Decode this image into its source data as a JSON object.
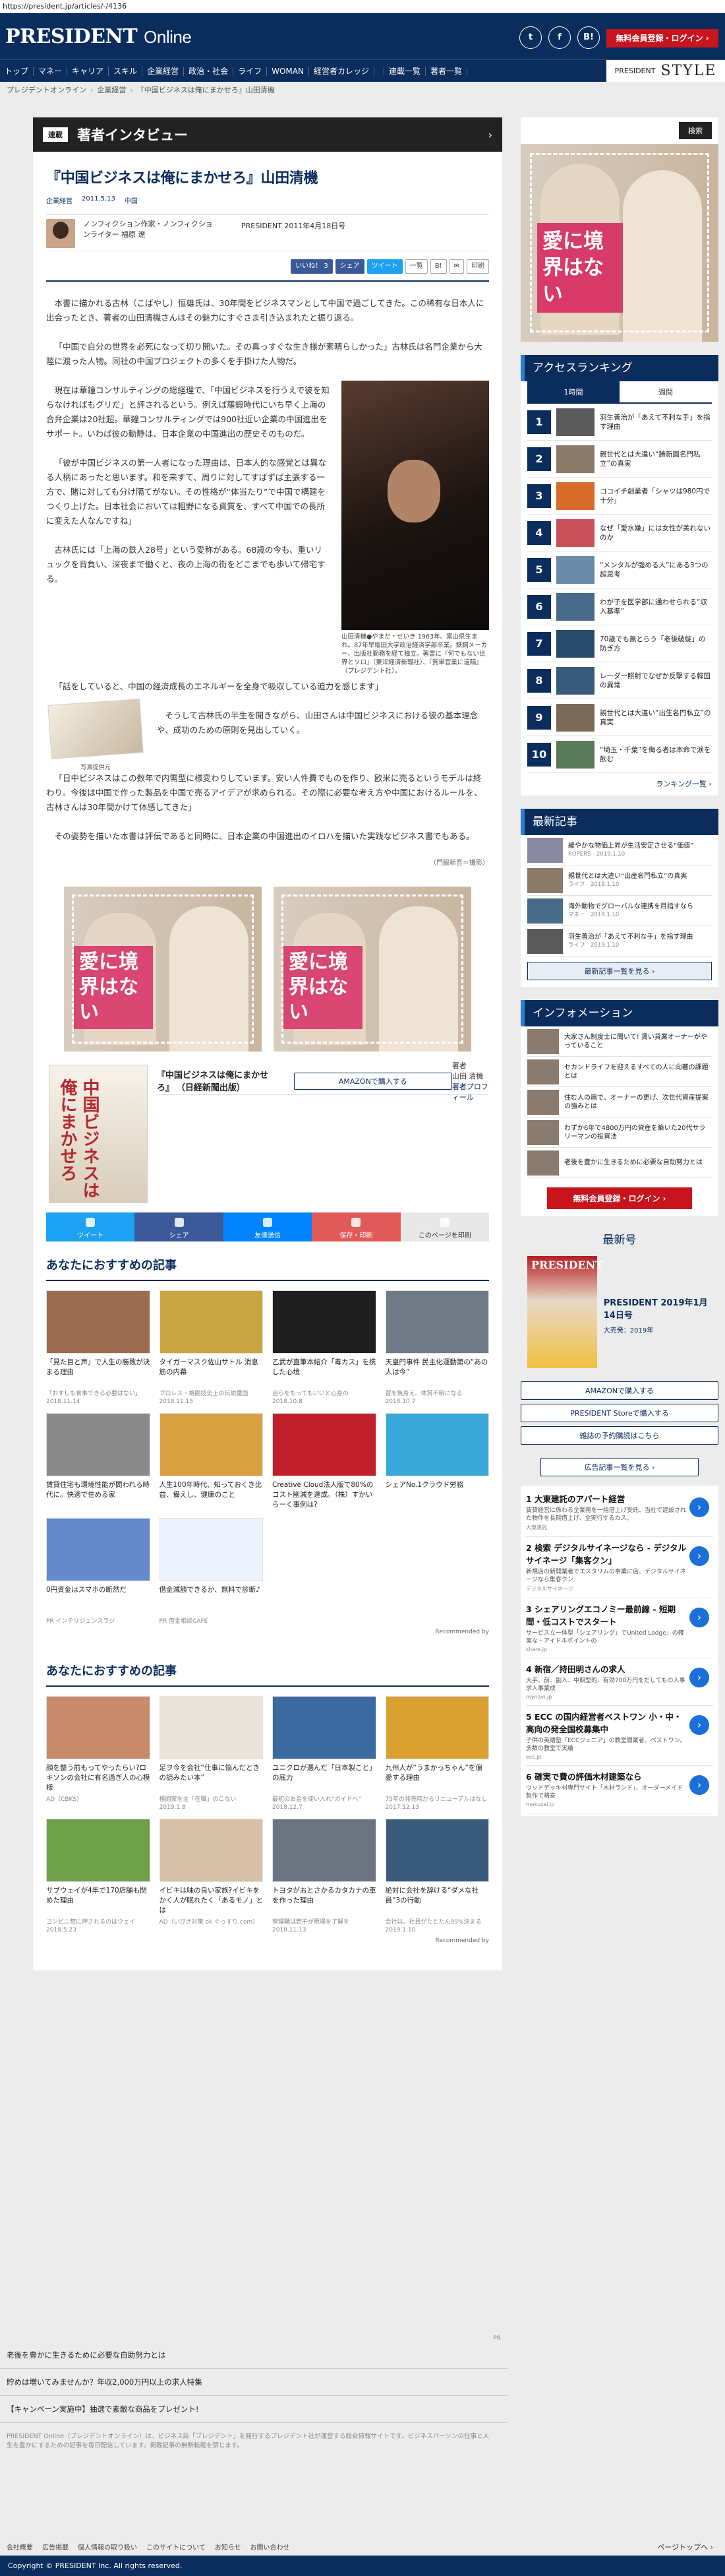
{
  "url": "https://president.jp/articles/-/4136",
  "header": {
    "logo_main": "PRESIDENT",
    "logo_sub": "Online",
    "icons": [
      {
        "name": "twitter-icon",
        "glyph": "t"
      },
      {
        "name": "facebook-icon",
        "glyph": "f"
      },
      {
        "name": "hatena-icon",
        "glyph": "B!"
      }
    ],
    "register_label": "無料会員登録・ログイン ›"
  },
  "nav": {
    "items": [
      "トップ",
      "マネー",
      "キャリア",
      "スキル",
      "企業経営",
      "政治・社会",
      "ライフ",
      "WOMAN",
      "経営者カレッジ",
      "連載一覧",
      "著者一覧"
    ],
    "style_prefix": "PRESIDENT",
    "style_label": "STYLE"
  },
  "breadcrumb": [
    "プレジデントオンライン",
    "企業経営",
    "『中国ビジネスは俺にまかせろ』山田清機"
  ],
  "section": {
    "tag": "連載",
    "title": "著者インタビュー"
  },
  "article": {
    "title": "『中国ビジネスは俺にまかせろ』山田清機",
    "meta": [
      "企業経営",
      "2011.5.13",
      "中国"
    ],
    "author": "ノンフィクション作家・ノンフィクションライター 福原 遼",
    "source": "PRESIDENT 2011年4月18日号",
    "share": [
      "いいね！ 3",
      "シェア",
      "ツイート",
      "一覧",
      "B!",
      "✉",
      "印刷"
    ],
    "paragraphs": [
      "本書に描かれる古林（こばやし）恒雄氏は、30年間をビジネスマンとして中国で過ごしてきた。この稀有な日本人に出会ったとき、著者の山田清機さんはその魅力にすぐさま引き込まれたと振り返る。",
      "「中国で自分の世界を必死になって切り開いた。その真っすぐな生き様が素晴らしかった」古林氏は名門企業から大陸に渡った人物。同社の中国プロジェクトの多くを手掛けた人物だ。",
      "現在は華鐘コンサルティングの総経理で、「中国ビジネスを行うえで彼を知らなければもグリだ」と評されるという。例えば羅鍛時代にいち早く上海の合弁企業は20社超。華鐘コンサルティングでは900社近い企業の中国進出をサポート。いわば彼の動静は、日本企業の中国進出の歴史そのものだ。",
      "「彼が中国ビジネスの第一人者になった理由は、日本人的な感覚とは異なる人柄にあったと思います。和を来すて、周りに対してすばずば主張する一方で、賭に対しても分け隔てがない。その性格が“体当たり”で中国で構建をつくり上げた。日本社会においては粗野になる資質を、すべて中国での長所に変えた人なんですね」",
      "古林氏には「上海の鉄人28号」という愛称がある。68歳の今も、重いリュックを背負い、深夜まで働くと、夜の上海の街をどこまでも歩いて帰宅する。",
      "「話をしていると、中国の経済成長のエネルギーを全身で吸収している迫力を感じます」",
      "そうして古林氏の半生を聞きながら、山田さんは中国ビジネスにおける彼の基本理念や、成功のための原則を見出していく。",
      "「日中ビジネスはこの数年で内需型に様変わりしています。安い人件費でものを作り、欧米に売るというモデルは終わり。今後は中国で作った製品を中国で売るアイデアが求められる。その際に必要な考え方や中国におけるルールを、古林さんは30年間かけて体感してきた」",
      "その姿勢を描いた本書は評伝であると同時に、日本企業の中国進出のイロハを描いた実践なビジネス書でもある。"
    ],
    "photo_caption": "山田清機●やまだ・せいき 1963年、富山県生まれ。87年早稲田大学政治経済学部卒業。鉄鋼メーカー、出版社勤務を経て独立。著書に『何でもない世界とソロ』（東洋経済新報社）、『質単官業に遠隔』（プレジデント社）。",
    "inline_book_caption": "写真提供元",
    "credit": "（門脇新吾＝撮影）"
  },
  "ad_banner": {
    "text": "愛に境界はない"
  },
  "book": {
    "title": "『中国ビジネスは俺にまかせろ』",
    "publisher": "（日経新聞出版）",
    "amazon_label": "AMAZONで購入する",
    "author_label": "著者",
    "author_name": "山田 清機",
    "profile_label": "著者プロフィール",
    "cover_text": "中国ビジネスは俺にまかせろ"
  },
  "sharebar": [
    {
      "label": "ツイート",
      "color": "#1da1f2"
    },
    {
      "label": "シェア",
      "color": "#3b5998"
    },
    {
      "label": "友達送信",
      "color": "#0084ff"
    },
    {
      "label": "保存・印刷",
      "color": "#e05a5a"
    },
    {
      "label": "このページを印刷",
      "color": "#e8e8e8"
    }
  ],
  "recommend1": {
    "title": "あなたにおすすめの記事",
    "items": [
      {
        "title": "「見た目と声」で人生の勝敗が決まる理由",
        "source": "「おすしも食事できる必要はない」",
        "date": "2018.11.14",
        "color": "#9b6c4f"
      },
      {
        "title": "タイガーマスク佐山サトル 消息筋の内幕",
        "source": "プロレス・格闘技史上の伝説覆面",
        "date": "2018.11.15",
        "color": "#c8a540"
      },
      {
        "title": "乙武が直筆本紹介「毒カス」を携した心境",
        "source": "自らをもってもいいと心身の",
        "date": "2018.10.8",
        "color": "#1f1f1f"
      },
      {
        "title": "天皇門事件 民主化運動第の“あの人は今”",
        "source": "習を無身え、体質不明になる",
        "date": "2018.10.7",
        "color": "#6f7a86"
      },
      {
        "title": "賃貸住宅も環境性能が問われる時代に。快適で住める家",
        "source": "",
        "date": "",
        "color": "#8a8a8a"
      },
      {
        "title": "人生100年時代、知っておくき比益、備えし、健康のこと",
        "source": "",
        "date": "",
        "color": "#d8a040"
      },
      {
        "title": "Creative Cloud法人版で80%のコスト削減を達成。（株）すかいらーく事例は?",
        "source": "",
        "date": "",
        "color": "#c0202a"
      },
      {
        "title": "シェアNo.1クラウド労務",
        "source": "",
        "date": "",
        "color": "#3aa8d8"
      },
      {
        "title": "0円資金はスマホの断然だ",
        "source": "PR インテリジェンスラジ",
        "date": "",
        "color": "#6688cc"
      },
      {
        "title": "借金減額できるか、無料で診断♪",
        "source": "PR 借金相談CAFE",
        "date": "",
        "color": "#eef4ff"
      }
    ],
    "by": "Recommended by"
  },
  "recommend2": {
    "title": "あなたにおすすめの記事",
    "items": [
      {
        "title": "顔を整う前もってやったらい?ロキソンの会社に有名過ぎ人の心模様",
        "source": "AD（CBKS)",
        "date": "",
        "color": "#c88a6a"
      },
      {
        "title": "足ヲ今を会社“仕事に悩んだときの読みたい本”",
        "source": "格闘家を主「在職」のこない",
        "date": "2019.1.8",
        "color": "#e8e4dc"
      },
      {
        "title": "ユニクロが選んだ「日本製こと」の底力",
        "source": "最初のお金を使い入れ“ガイドへ”",
        "date": "2018.12.7",
        "color": "#3a6aa0"
      },
      {
        "title": "九州人が“うまかっちゃん”を偏愛する理由",
        "source": "75年の発売時からリニューアルはなし",
        "date": "2017.12.13",
        "color": "#d8a030"
      },
      {
        "title": "サブウェイが4年で170店舗も閉めた理由",
        "source": "コンビニ惣に押されるのはウェイ",
        "date": "2018.5.23",
        "color": "#6ea04a"
      },
      {
        "title": "イビキは味の良い家族?イビキをかく人が眠れたく「あるモノ」とは",
        "source": "AD（いびき対策 ok ぐっすり.com)",
        "date": "",
        "color": "#d8c0a8"
      },
      {
        "title": "トヨタがおとさかるカタカナの車を作った理由",
        "source": "管理職は若干が現場を了解を",
        "date": "2018.11.13",
        "color": "#6a7480"
      },
      {
        "title": "絶対に会社を辞ける“ダメな社員”3の行動",
        "source": "会社は、社員がたとたん99%決まる",
        "date": "2019.1.10",
        "color": "#3a5a7a"
      }
    ],
    "by": "Recommended by"
  },
  "rail": {
    "search_label": "検索",
    "ranking_title": "アクセスランキング",
    "tabs": [
      "1時間",
      "週間"
    ],
    "ranking": [
      {
        "n": "1",
        "t": "羽生善治が「あえて不利な手」を指す理由",
        "c": "#5a5a5a"
      },
      {
        "n": "2",
        "t": "親世代とは大違い“勝新園名門私立”の真実",
        "c": "#8a7a6a"
      },
      {
        "n": "3",
        "t": "ココイチ創業者「シャツは980円で十分」",
        "c": "#d86a2a"
      },
      {
        "n": "4",
        "t": "なぜ「愛水嫌」には女性が美れないのか",
        "c": "#c8505a"
      },
      {
        "n": "5",
        "t": "“メンタルが強める人”にある3つの超思考",
        "c": "#6a8aa8"
      },
      {
        "n": "6",
        "t": "わが子を医学部に通わせられる“収入基準”",
        "c": "#4a6a8a"
      },
      {
        "n": "7",
        "t": "70歳でも無とらう「老後破綻」の防ぎ方",
        "c": "#2a4a6a"
      },
      {
        "n": "8",
        "t": "レーダー照射でなぜか反撃する韓国の異常",
        "c": "#3a5a7a"
      },
      {
        "n": "9",
        "t": "親世代とは大違い“出生名門私立”の真実",
        "c": "#7a6a5a"
      },
      {
        "n": "10",
        "t": "“埼玉・千葉”を侮る者は本命で涙を飲む",
        "c": "#5a7a5a"
      }
    ],
    "ranking_more": "ランキング一覧 ›",
    "latest_title": "最新記事",
    "latest": [
      {
        "t": "緩やかな物価上昇が生活安定させる“価値”",
        "s": "ROPERS　2019.1.10",
        "c": "#8a8aa0"
      },
      {
        "t": "親世代とは大違い“出産名門私立”の真実",
        "s": "ライフ　2019.1.10",
        "c": "#8a7a6a"
      },
      {
        "t": "海外動物でグローバルな連携を目指すなら",
        "s": "マネー　2019.1.10",
        "c": "#4a6a8a"
      },
      {
        "t": "羽生善治が「あえて不利な手」を指す理由",
        "s": "ライフ　2019.1.10",
        "c": "#5a5a5a"
      }
    ],
    "latest_more": "最新記事一覧を見る ›",
    "info_title": "インフォメーション",
    "info": [
      {
        "t": "大家さん制度士に聞いて! 賃い貸業オーナーがやっていること"
      },
      {
        "t": "セカンドライフを迎えるすべての人に向著の課題とは"
      },
      {
        "t": "住む人の眉で、オーナーの更げ、次世代資産提案の強みとは"
      },
      {
        "t": "わずか6年で4800万円の資産を築いた20代サラリーマンの投資法"
      },
      {
        "t": "老後を豊かに生きるために必要な自助努力とは"
      }
    ],
    "register_label": "無料会員登録・ログイン ›",
    "latest_issue_title": "最新号",
    "magazine": {
      "cover_logo": "PRESIDENT",
      "title": "PRESIDENT 2019年1月14日号",
      "issue": "大売発：2019年"
    },
    "buttons": [
      "AMAZONで購入する",
      "PRESIDENT Storeで購入する",
      "雑誌の予約購読はこちら"
    ],
    "ad_link": "広告記事一覧を見る ›",
    "ads": [
      {
        "n": "1",
        "h": "大東建託のアパート経営",
        "d": "賃貸経営に係わる全業務を一括借上げ受託、当社で建設された物件を長期借上げ、全実行するカス。",
        "s": "大東建託"
      },
      {
        "n": "2",
        "h": "検索 デジタルサイネージなら - デジタルサイネージ「集客クン」",
        "d": "新規店の新開業者でエスタリムの事業に店、デジタルサイネージなら集客クン",
        "s": "デジタルサイネージ"
      },
      {
        "n": "3",
        "h": "シェアリングエコノミー最前線 - 短期間・低コストでスタート",
        "d": "サービス立一体型「シェアリング」でUnited Lodge」の確実な・アイドルポイントの",
        "s": "share.jp"
      },
      {
        "n": "4",
        "h": "新宿／持田明さんの求人",
        "d": "大手、前、副入、中期型的、有効700万円をだしてもの人事求人事業成",
        "s": "mynavi.jp"
      },
      {
        "n": "5",
        "h": "ECC の国内経営者ベストワン 小・中・高向の発全国校募集中",
        "d": "子供の英語塾「ECCジュニア」の教室開業者、ベストワン。 多数の教室で実績",
        "s": "ecc.jp"
      },
      {
        "n": "6",
        "h": "確実で費の評価木材建築なら",
        "d": "ウッドデッキ材専門サイト「木材ランド」、オーダーメイド製作で格安",
        "s": "mokuzai.jp"
      }
    ]
  },
  "bottom": {
    "links": [
      "老後を豊かに生きるために必要な自助努力とは",
      "貯めは増いてみませんか？年収2,000万円以上の求人特集",
      "【キャンペーン実施中】抽選で素敵な商品をプレゼント!"
    ],
    "pr_label": "PR",
    "disclaimer": "PRESIDENT Online（プレジデントオンライン）は、ビジネス誌「プレジデント」を発行するプレジデント社が運営する総合情報サイトです。ビジネスパーソンの仕事と人生を豊かにするための記事を毎日配信しています。掲載記事の無断転載を禁じます。",
    "foot_links": [
      "会社概要",
      "広告掲載",
      "個人情報の取り扱い",
      "このサイトについて",
      "お知らせ",
      "お問い合わせ"
    ],
    "pagetop": "ページトップへ ›",
    "copyright": "Copyright © PRESIDENT Inc. All rights reserved."
  }
}
